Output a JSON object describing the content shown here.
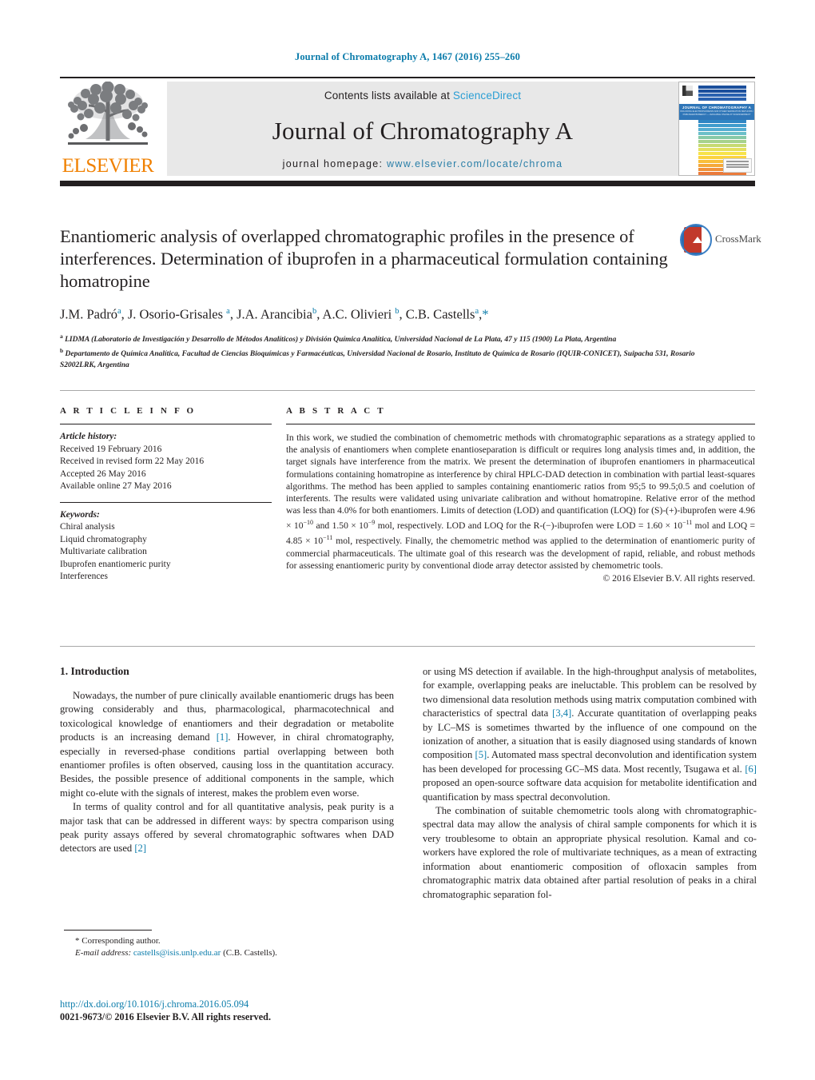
{
  "running_head": "Journal of Chromatography A, 1467 (2016) 255–260",
  "masthead": {
    "contents_prefix": "Contents lists available at ",
    "sciencedirect": "ScienceDirect",
    "journal_title": "Journal of Chromatography A",
    "homepage_prefix": "journal homepage: ",
    "homepage_url": "www.elsevier.com/locate/chroma",
    "publisher": "ELSEVIER",
    "cover_band_title": "JOURNAL OF CHROMATOGRAPHY A",
    "cover_band_sub": "INCLUDING ELECTROPHORESIS AND OTHER SEPARATION METHODS / PUBLISHED BIWEEKLY — AVAILABLE ONLINE AT SCIENCEDIRECT"
  },
  "colors": {
    "link_blue": "#0b7cab",
    "sciencedirect_blue": "#2a9ed4",
    "elsevier_orange": "#f08000",
    "rule_black": "#231f20",
    "panel_grey": "#e8e8e8"
  },
  "article": {
    "title": "Enantiomeric analysis of overlapped chromatographic profiles in the presence of interferences. Determination of ibuprofen in a pharmaceutical formulation containing homatropine",
    "crossmark_label": "CrossMark",
    "authors_html": "J.M. Padró<sup>a</sup>, J. Osorio-Grisales <sup>a</sup>, J.A. Arancibia<sup>b</sup>, A.C. Olivieri <sup>b</sup>, C.B. Castells<sup>a</sup>,<span class=\"star\">*</span>",
    "affiliations": [
      "<sup>a</sup> LIDMA (Laboratorio de Investigación y Desarrollo de Métodos Analíticos) y División Química Analítica, Universidad Nacional de La Plata, 47 y 115 (1900) La Plata, Argentina",
      "<sup>b</sup> Departamento de Química Analítica, Facultad de Ciencias Bioquímicas y Farmacéuticas, Universidad Nacional de Rosario, Instituto de Química de Rosario (IQUIR-CONICET), Suipacha 531, Rosario S2002LRK, Argentina"
    ]
  },
  "article_info": {
    "label": "A R T I C L E    I N F O",
    "history_head": "Article history:",
    "history": [
      "Received 19 February 2016",
      "Received in revised form 22 May 2016",
      "Accepted 26 May 2016",
      "Available online 27 May 2016"
    ],
    "keywords_head": "Keywords:",
    "keywords": [
      "Chiral analysis",
      "Liquid chromatography",
      "Multivariate calibration",
      "Ibuprofen enantiomeric purity",
      "Interferences"
    ]
  },
  "abstract": {
    "label": "A B S T R A C T",
    "text_html": "In this work, we studied the combination of chemometric methods with chromatographic separations as a strategy applied to the analysis of enantiomers when complete enantioseparation is difficult or requires long analysis times and, in addition, the target signals have interference from the matrix. We present the determination of ibuprofen enantiomers in pharmaceutical formulations containing homatropine as interference by chiral HPLC-DAD detection in combination with partial least-squares algorithms. The method has been applied to samples containing enantiomeric ratios from 95;5 to 99.5;0.5 and coelution of interferents. The results were validated using univariate calibration and without homatropine. Relative error of the method was less than 4.0% for both enantiomers. Limits of detection (LOD) and quantification (LOQ) for (S)-(+)-ibuprofen were 4.96 × 10<sup>−10</sup> and 1.50 × 10<sup>−9</sup> mol, respectively. LOD and LOQ for the R-(−)-ibuprofen were LOD = 1.60 × 10<sup>−11</sup> mol and LOQ = 4.85 × 10<sup>−11</sup> mol, respectively. Finally, the chemometric method was applied to the determination of enantiomeric purity of commercial pharmaceuticals. The ultimate goal of this research was the development of rapid, reliable, and robust methods for assessing enantiomeric purity by conventional diode array detector assisted by chemometric tools.",
    "copyright": "© 2016 Elsevier B.V. All rights reserved."
  },
  "introduction": {
    "heading": "1. Introduction",
    "left_paragraphs_html": [
      "Nowadays, the number of pure clinically available enantiomeric drugs has been growing considerably and thus, pharmacological, pharmacotechnical and toxicological knowledge of enantiomers and their degradation or metabolite products is an increasing demand <span class=\"ref\">[1]</span>. However, in chiral chromatography, especially in reversed-phase conditions partial overlapping between both enantiomer profiles is often observed, causing loss in the quantitation accuracy. Besides, the possible presence of additional components in the sample, which might co-elute with the signals of interest, makes the problem even worse.",
      "In terms of quality control and for all quantitative analysis, peak purity is a major task that can be addressed in different ways: by spectra comparison using peak purity assays offered by several chromatographic softwares when DAD detectors are used <span class=\"ref\">[2]</span>"
    ],
    "right_paragraphs_html": [
      "or using MS detection if available. In the high-throughput analysis of metabolites, for example, overlapping peaks are ineluctable. This problem can be resolved by two dimensional data resolution methods using matrix computation combined with characteristics of spectral data <span class=\"ref\">[3,4]</span>. Accurate quantitation of overlapping peaks by LC–MS is sometimes thwarted by the influence of one compound on the ionization of another, a situation that is easily diagnosed using standards of known composition <span class=\"ref\">[5]</span>. Automated mass spectral deconvolution and identification system has been developed for processing GC–MS data. Most recently, Tsugawa et al. <span class=\"ref\">[6]</span> proposed an open-source software data acquision for metabolite identification and quantification by mass spectral deconvolution.",
      "The combination of suitable chemometric tools along with chromatographic-spectral data may allow the analysis of chiral sample components for which it is very troublesome to obtain an appropriate physical resolution. Kamal and co-workers have explored the role of multivariate techniques, as a mean of extracting information about enantiomeric composition of ofloxacin samples from chromatographic matrix data obtained after partial resolution of peaks in a chiral chromatographic separation fol-"
    ]
  },
  "footnotes": {
    "corresponding": "* Corresponding author.",
    "email_label": "E-mail address:",
    "email": "castells@isis.unlp.edu.ar",
    "email_owner": "(C.B. Castells)."
  },
  "footer": {
    "doi": "http://dx.doi.org/10.1016/j.chroma.2016.05.094",
    "issn_line": "0021-9673/© 2016 Elsevier B.V. All rights reserved."
  }
}
